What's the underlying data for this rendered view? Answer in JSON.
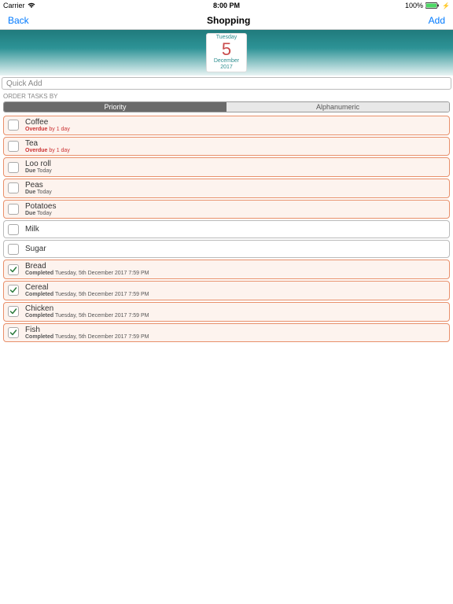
{
  "status": {
    "carrier": "Carrier",
    "time": "8:00 PM",
    "battery": "100%"
  },
  "nav": {
    "back": "Back",
    "title": "Shopping",
    "add": "Add"
  },
  "date": {
    "weekday": "Tuesday",
    "day": "5",
    "month": "December",
    "year": "2017"
  },
  "quickadd": {
    "placeholder": "Quick Add"
  },
  "order": {
    "label": "ORDER TASKS BY",
    "priority": "Priority",
    "alpha": "Alphanumeric"
  },
  "tasks": [
    {
      "name": "Coffee",
      "sub_pre": "Overdue",
      "sub_post": " by 1 day",
      "overdue": true,
      "checked": false,
      "plain": false
    },
    {
      "name": "Tea",
      "sub_pre": "Overdue",
      "sub_post": " by 1 day",
      "overdue": true,
      "checked": false,
      "plain": false
    },
    {
      "name": "Loo roll",
      "sub_pre": "Due",
      "sub_post": " Today",
      "overdue": false,
      "checked": false,
      "plain": false
    },
    {
      "name": "Peas",
      "sub_pre": "Due",
      "sub_post": " Today",
      "overdue": false,
      "checked": false,
      "plain": false
    },
    {
      "name": "Potatoes",
      "sub_pre": "Due",
      "sub_post": " Today",
      "overdue": false,
      "checked": false,
      "plain": false
    },
    {
      "name": "Milk",
      "sub_pre": "",
      "sub_post": "",
      "overdue": false,
      "checked": false,
      "plain": true
    },
    {
      "name": "Sugar",
      "sub_pre": "",
      "sub_post": "",
      "overdue": false,
      "checked": false,
      "plain": true
    },
    {
      "name": "Bread",
      "sub_pre": "Completed",
      "sub_post": " Tuesday, 5th December 2017 7:59 PM",
      "overdue": false,
      "checked": true,
      "plain": false
    },
    {
      "name": "Cereal",
      "sub_pre": "Completed",
      "sub_post": " Tuesday, 5th December 2017 7:59 PM",
      "overdue": false,
      "checked": true,
      "plain": false
    },
    {
      "name": "Chicken",
      "sub_pre": "Completed",
      "sub_post": " Tuesday, 5th December 2017 7:59 PM",
      "overdue": false,
      "checked": true,
      "plain": false
    },
    {
      "name": "Fish",
      "sub_pre": "Completed",
      "sub_post": " Tuesday, 5th December 2017 7:59 PM",
      "overdue": false,
      "checked": true,
      "plain": false
    }
  ]
}
